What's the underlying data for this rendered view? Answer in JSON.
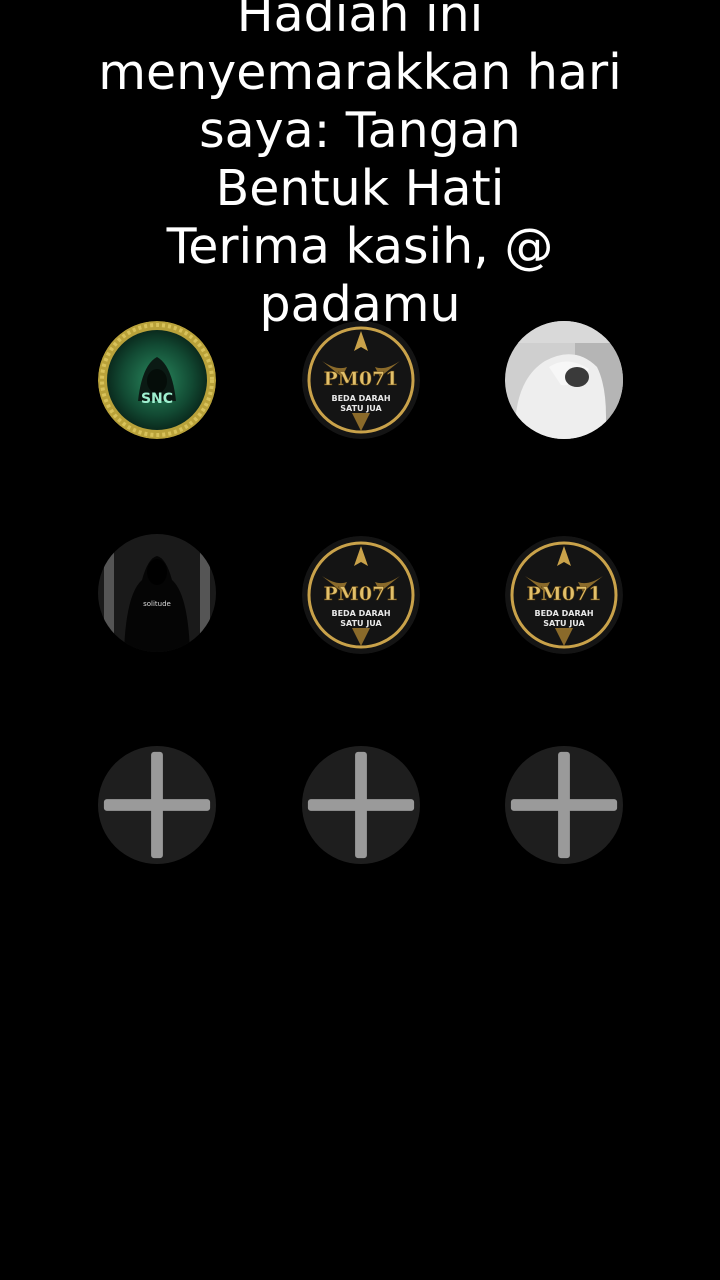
{
  "caption": {
    "lines": [
      "Hadiah ini",
      "menyemarakkan hari",
      "saya: Tangan",
      "Bentuk Hati",
      "Terima kasih, @",
      "padamu"
    ]
  },
  "avatars": [
    {
      "kind": "snc-logo",
      "badge_text": "SNC"
    },
    {
      "kind": "pm071-logo",
      "badge_text": "PM071",
      "subtitle_1": "BEDA DARAH",
      "subtitle_2": "SATU JUA"
    },
    {
      "kind": "photo-veiled-person"
    },
    {
      "kind": "hooded-figure",
      "badge_text": "solitude"
    },
    {
      "kind": "pm071-logo",
      "badge_text": "PM071",
      "subtitle_1": "BEDA DARAH",
      "subtitle_2": "SATU JUA"
    },
    {
      "kind": "pm071-logo",
      "badge_text": "PM071",
      "subtitle_1": "BEDA DARAH",
      "subtitle_2": "SATU JUA"
    }
  ],
  "add_slots": [
    {
      "icon": "plus-icon"
    },
    {
      "icon": "plus-icon"
    },
    {
      "icon": "plus-icon"
    }
  ],
  "colors": {
    "background": "#000000",
    "text": "#ffffff",
    "add_slot_bg": "#1e1e1e",
    "plus": "#9a9a9a",
    "gold": "#c9a24a",
    "snc_green": "#1f6b4a"
  }
}
